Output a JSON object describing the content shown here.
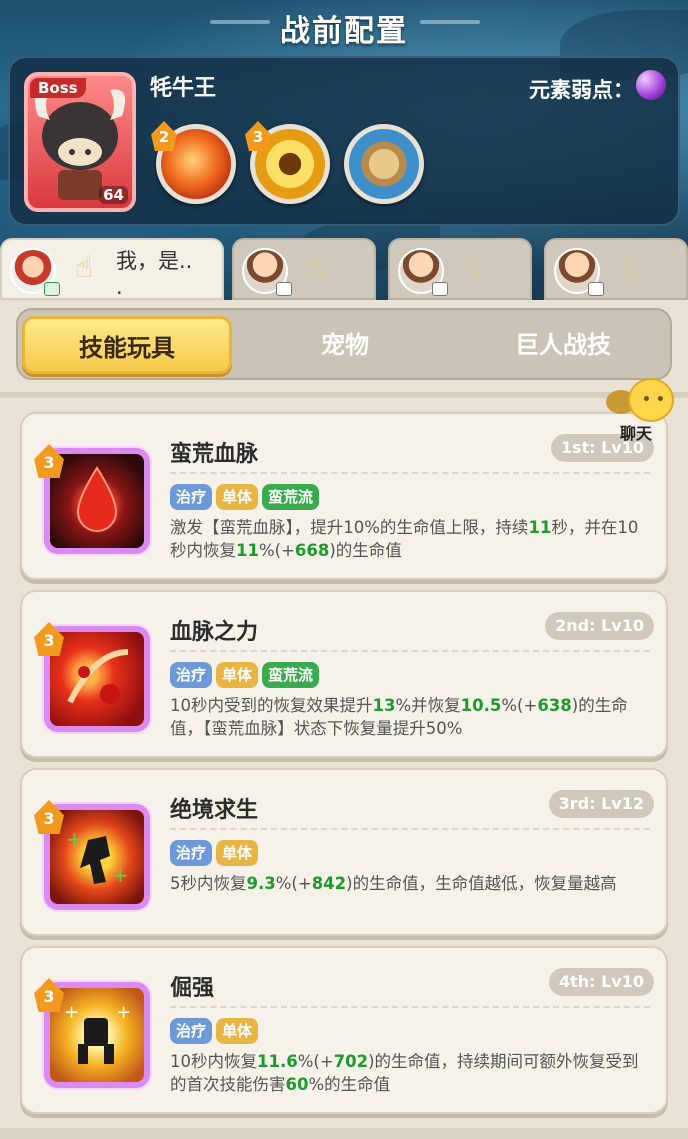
{
  "page_title": "战前配置",
  "boss": {
    "tag": "Boss",
    "level": "64",
    "name": "牦牛王",
    "weakness_label": "元素弱点：",
    "weakness_icon": "moon-icon",
    "skills": [
      {
        "level": "2",
        "icon": "fire-claw-icon",
        "color": "#e8501c"
      },
      {
        "level": "3",
        "icon": "golden-ring-icon",
        "color": "#e5a21a"
      },
      {
        "level": "",
        "icon": "rock-shield-icon",
        "color": "#3e8fc9"
      }
    ]
  },
  "party": [
    {
      "text": "我，是..\n.",
      "active": true
    },
    {
      "text": "",
      "active": false
    },
    {
      "text": "",
      "active": false
    },
    {
      "text": "",
      "active": false
    }
  ],
  "tabs": [
    "技能玩具",
    "宠物",
    "巨人战技"
  ],
  "active_tab": 0,
  "chat": {
    "label": "聊天"
  },
  "skills": [
    {
      "name": "蛮荒血脉",
      "slot": "1st: Lv10",
      "badge": "3",
      "tags": [
        "治疗",
        "单体",
        "蛮荒流"
      ],
      "desc_html": "激发【蛮荒血脉】，提升10%的生命值上限，持续<span class=\"g\">11</span>秒，并在10秒内恢复<span class=\"g\">11</span>%(+<span class=\"g\">668</span>)的生命值"
    },
    {
      "name": "血脉之力",
      "slot": "2nd: Lv10",
      "badge": "3",
      "tags": [
        "治疗",
        "单体",
        "蛮荒流"
      ],
      "desc_html": "10秒内受到的恢复效果提升<span class=\"g\">13</span>%并恢复<span class=\"g\">10.5</span>%(+<span class=\"g\">638</span>)的生命值，【蛮荒血脉】状态下恢复量提升50%"
    },
    {
      "name": "绝境求生",
      "slot": "3rd: Lv12",
      "badge": "3",
      "tags": [
        "治疗",
        "单体"
      ],
      "desc_html": "5秒内恢复<span class=\"g\">9.3</span>%(+<span class=\"g\">842</span>)的生命值，生命值越低，恢复量越高"
    },
    {
      "name": "倔强",
      "slot": "4th: Lv10",
      "badge": "3",
      "tags": [
        "治疗",
        "单体"
      ],
      "desc_html": "10秒内恢复<span class=\"g\">11.6</span>%(+<span class=\"g\">702</span>)的生命值，持续期间可额外恢复受到的首次技能伤害<span class=\"g\">60</span>%的生命值"
    }
  ]
}
